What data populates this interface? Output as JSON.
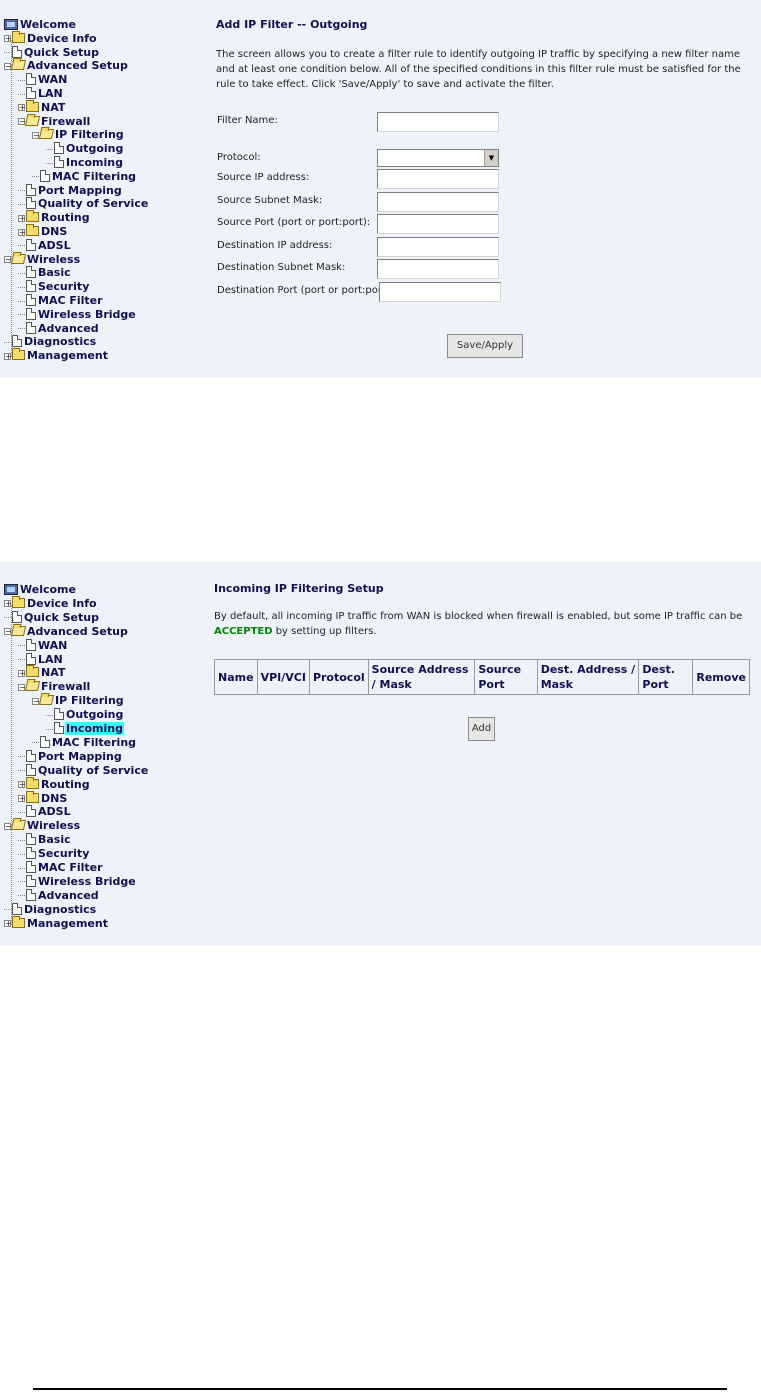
{
  "outgoing_screen": {
    "tree": [
      {
        "label": "Welcome",
        "icon": "computer-icon",
        "expander": "none",
        "connector": "none",
        "indent": 0
      },
      {
        "label": "Device Info",
        "icon": "folder-icon",
        "expander": "plus",
        "indent": 0
      },
      {
        "label": "Quick Setup",
        "icon": "page-icon",
        "expander": "none",
        "indent": 0
      },
      {
        "label": "Advanced Setup",
        "icon": "open-folder-icon",
        "expander": "minus",
        "indent": 0
      },
      {
        "label": "WAN",
        "icon": "page-icon",
        "expander": "none",
        "indent": 1
      },
      {
        "label": "LAN",
        "icon": "page-icon",
        "expander": "none",
        "indent": 1
      },
      {
        "label": "NAT",
        "icon": "folder-icon",
        "expander": "plus",
        "indent": 1
      },
      {
        "label": "Firewall",
        "icon": "open-folder-icon",
        "expander": "minus",
        "indent": 1
      },
      {
        "label": "IP Filtering",
        "icon": "open-folder-icon",
        "expander": "minus",
        "indent": 2
      },
      {
        "label": "Outgoing",
        "icon": "page-icon",
        "expander": "none",
        "indent": 3
      },
      {
        "label": "Incoming",
        "icon": "page-icon",
        "expander": "none",
        "indent": 3
      },
      {
        "label": "MAC Filtering",
        "icon": "page-icon",
        "expander": "none",
        "indent": 2
      },
      {
        "label": "Port Mapping",
        "icon": "page-icon",
        "expander": "none",
        "indent": 1
      },
      {
        "label": "Quality of Service",
        "icon": "page-icon",
        "expander": "none",
        "indent": 1
      },
      {
        "label": "Routing",
        "icon": "folder-icon",
        "expander": "plus",
        "indent": 1
      },
      {
        "label": "DNS",
        "icon": "folder-icon",
        "expander": "plus",
        "indent": 1
      },
      {
        "label": "ADSL",
        "icon": "page-icon",
        "expander": "none",
        "indent": 1
      },
      {
        "label": "Wireless",
        "icon": "open-folder-icon",
        "expander": "minus",
        "indent": 0
      },
      {
        "label": "Basic",
        "icon": "page-icon",
        "expander": "none",
        "indent": 1
      },
      {
        "label": "Security",
        "icon": "page-icon",
        "expander": "none",
        "indent": 1
      },
      {
        "label": "MAC Filter",
        "icon": "page-icon",
        "expander": "none",
        "indent": 1
      },
      {
        "label": "Wireless Bridge",
        "icon": "page-icon",
        "expander": "none",
        "indent": 1
      },
      {
        "label": "Advanced",
        "icon": "page-icon",
        "expander": "none",
        "indent": 1
      },
      {
        "label": "Diagnostics",
        "icon": "page-icon",
        "expander": "none",
        "indent": 0
      },
      {
        "label": "Management",
        "icon": "folder-icon",
        "expander": "plus",
        "indent": 0
      }
    ],
    "title": "Add IP Filter -- Outgoing",
    "description": "The screen allows you to create a filter rule to identify outgoing IP traffic by specifying a new filter name and at least one condition below. All of the specified conditions in this filter rule must be satisfied for the rule to take effect. Click 'Save/Apply' to save and activate the filter.",
    "fields": {
      "filter_name": {
        "label": "Filter Name:",
        "value": ""
      },
      "protocol": {
        "label": "Protocol:",
        "value": ""
      },
      "source_ip": {
        "label": "Source IP address:",
        "value": ""
      },
      "source_mask": {
        "label": "Source Subnet Mask:",
        "value": ""
      },
      "source_port": {
        "label": "Source Port (port or port:port):",
        "value": ""
      },
      "dest_ip": {
        "label": "Destination IP address:",
        "value": ""
      },
      "dest_mask": {
        "label": "Destination Subnet Mask:",
        "value": ""
      },
      "dest_port": {
        "label": "Destination Port (port or port:port):",
        "value": ""
      }
    },
    "save_button": "Save/Apply"
  },
  "incoming_screen": {
    "selected_item": "Incoming",
    "title": "Incoming IP Filtering Setup",
    "description_before": "By default, all incoming IP traffic from WAN is blocked when firewall is enabled, but some IP traffic can be ",
    "description_highlight": "ACCEPTED",
    "description_after": " by setting up filters.",
    "table_headers": [
      "Name",
      "VPI/VCI",
      "Protocol",
      "Source Address / Mask",
      "Source Port",
      "Dest. Address / Mask",
      "Dest. Port",
      "Remove"
    ],
    "add_button": "Add"
  },
  "colors": {
    "panel_background": "#eef2fa",
    "tree_text": "#101050",
    "selection_highlight": "#33ffff",
    "accepted_text": "#008800"
  }
}
